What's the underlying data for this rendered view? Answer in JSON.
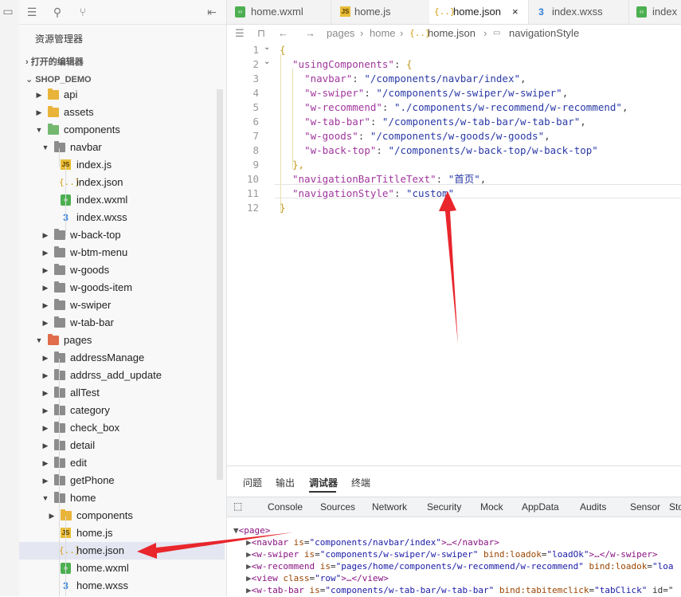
{
  "sidebar": {
    "title": "资源管理器",
    "open_editors": "打开的编辑器",
    "project": "SHOP_DEMO",
    "tree": [
      {
        "label": "api",
        "kind": "folder",
        "color": "yellow",
        "depth": 1,
        "arrow": "right"
      },
      {
        "label": "assets",
        "kind": "folder",
        "color": "yellow",
        "depth": 1,
        "arrow": "right"
      },
      {
        "label": "components",
        "kind": "folder",
        "color": "green",
        "depth": 1,
        "arrow": "down"
      },
      {
        "label": "navbar",
        "kind": "folder",
        "color": "gray",
        "depth": 2,
        "arrow": "down"
      },
      {
        "label": "index.js",
        "kind": "js",
        "depth": 3
      },
      {
        "label": "index.json",
        "kind": "json",
        "depth": 3
      },
      {
        "label": "index.wxml",
        "kind": "wxml",
        "depth": 3
      },
      {
        "label": "index.wxss",
        "kind": "wxss",
        "depth": 3
      },
      {
        "label": "w-back-top",
        "kind": "folder",
        "color": "gray",
        "depth": 2,
        "arrow": "right"
      },
      {
        "label": "w-btm-menu",
        "kind": "folder",
        "color": "gray",
        "depth": 2,
        "arrow": "right"
      },
      {
        "label": "w-goods",
        "kind": "folder",
        "color": "gray",
        "depth": 2,
        "arrow": "right"
      },
      {
        "label": "w-goods-item",
        "kind": "folder",
        "color": "gray",
        "depth": 2,
        "arrow": "right"
      },
      {
        "label": "w-swiper",
        "kind": "folder",
        "color": "gray",
        "depth": 2,
        "arrow": "right"
      },
      {
        "label": "w-tab-bar",
        "kind": "folder",
        "color": "gray",
        "depth": 2,
        "arrow": "right"
      },
      {
        "label": "pages",
        "kind": "folder",
        "color": "red",
        "depth": 1,
        "arrow": "down"
      },
      {
        "label": "addressManage",
        "kind": "folder",
        "color": "gray",
        "depth": 2,
        "arrow": "right"
      },
      {
        "label": "addrss_add_update",
        "kind": "folder",
        "color": "gray",
        "depth": 2,
        "arrow": "right"
      },
      {
        "label": "allTest",
        "kind": "folder",
        "color": "gray",
        "depth": 2,
        "arrow": "right"
      },
      {
        "label": "category",
        "kind": "folder",
        "color": "gray",
        "depth": 2,
        "arrow": "right"
      },
      {
        "label": "check_box",
        "kind": "folder",
        "color": "gray",
        "depth": 2,
        "arrow": "right"
      },
      {
        "label": "detail",
        "kind": "folder",
        "color": "gray",
        "depth": 2,
        "arrow": "right"
      },
      {
        "label": "edit",
        "kind": "folder",
        "color": "gray",
        "depth": 2,
        "arrow": "right"
      },
      {
        "label": "getPhone",
        "kind": "folder",
        "color": "gray",
        "depth": 2,
        "arrow": "right"
      },
      {
        "label": "home",
        "kind": "folder",
        "color": "gray",
        "depth": 2,
        "arrow": "down"
      },
      {
        "label": "components",
        "kind": "folder",
        "color": "yellow",
        "depth": 3,
        "arrow": "right"
      },
      {
        "label": "home.js",
        "kind": "js",
        "depth": 3
      },
      {
        "label": "home.json",
        "kind": "json",
        "depth": 3,
        "selected": true
      },
      {
        "label": "home.wxml",
        "kind": "wxml",
        "depth": 3
      },
      {
        "label": "home.wxss",
        "kind": "wxss",
        "depth": 3
      }
    ]
  },
  "tabs": [
    {
      "label": "home.wxml",
      "kind": "wxml"
    },
    {
      "label": "home.js",
      "kind": "js"
    },
    {
      "label": "home.json",
      "kind": "json",
      "active": true,
      "close": "×"
    },
    {
      "label": "index.wxss",
      "kind": "wxss"
    },
    {
      "label": "index",
      "kind": "wxml"
    }
  ],
  "breadcrumb": [
    "pages",
    "home",
    "home.json",
    "navigationStyle"
  ],
  "code": {
    "line_numbers": [
      "1",
      "2",
      "3",
      "4",
      "5",
      "6",
      "7",
      "8",
      "9",
      "10",
      "11",
      "12"
    ],
    "lines": [
      [
        [
          "{",
          "bz"
        ]
      ],
      [
        [
          "  ",
          ""
        ],
        [
          "\"usingComponents\"",
          "k"
        ],
        [
          ": ",
          "p"
        ],
        [
          "{",
          "bz"
        ]
      ],
      [
        [
          "    ",
          ""
        ],
        [
          "\"navbar\"",
          "k"
        ],
        [
          ": ",
          "p"
        ],
        [
          "\"/components/navbar/index\"",
          "s"
        ],
        [
          ",",
          "p"
        ]
      ],
      [
        [
          "    ",
          ""
        ],
        [
          "\"w-swiper\"",
          "k"
        ],
        [
          ": ",
          "p"
        ],
        [
          "\"/components/w-swiper/w-swiper\"",
          "s"
        ],
        [
          ",",
          "p"
        ]
      ],
      [
        [
          "    ",
          ""
        ],
        [
          "\"w-recommend\"",
          "k"
        ],
        [
          ": ",
          "p"
        ],
        [
          "\"./components/w-recommend/w-recommend\"",
          "s"
        ],
        [
          ",",
          "p"
        ]
      ],
      [
        [
          "    ",
          ""
        ],
        [
          "\"w-tab-bar\"",
          "k"
        ],
        [
          ": ",
          "p"
        ],
        [
          "\"/components/w-tab-bar/w-tab-bar\"",
          "s"
        ],
        [
          ",",
          "p"
        ]
      ],
      [
        [
          "    ",
          ""
        ],
        [
          "\"w-goods\"",
          "k"
        ],
        [
          ": ",
          "p"
        ],
        [
          "\"/components/w-goods/w-goods\"",
          "s"
        ],
        [
          ",",
          "p"
        ]
      ],
      [
        [
          "    ",
          ""
        ],
        [
          "\"w-back-top\"",
          "k"
        ],
        [
          ": ",
          "p"
        ],
        [
          "\"/components/w-back-top/w-back-top\"",
          "s"
        ]
      ],
      [
        [
          "  ",
          ""
        ],
        [
          "},",
          "bz"
        ]
      ],
      [
        [
          "  ",
          ""
        ],
        [
          "\"navigationBarTitleText\"",
          "k"
        ],
        [
          ": ",
          "p"
        ],
        [
          "\"首页\"",
          "s"
        ],
        [
          ",",
          "p"
        ]
      ],
      [
        [
          "  ",
          ""
        ],
        [
          "\"navigationStyle\"",
          "k"
        ],
        [
          ": ",
          "p"
        ],
        [
          "\"custom\"",
          "s"
        ]
      ],
      [
        [
          "}",
          "bz"
        ]
      ]
    ]
  },
  "panel": {
    "tabs": [
      "问题",
      "输出",
      "调试器",
      "终端"
    ],
    "active_tab": "调试器",
    "devtools_tabs": [
      "Console",
      "Sources",
      "Network",
      "Security",
      "Mock",
      "AppData",
      "Audits",
      "Sensor",
      "Sto"
    ],
    "dom": [
      {
        "indent": 0,
        "tri": "▼",
        "parts": [
          [
            "<page>",
            "tag"
          ]
        ]
      },
      {
        "indent": 1,
        "tri": "▶",
        "parts": [
          [
            "<navbar ",
            "tag"
          ],
          [
            "is",
            "an"
          ],
          [
            "=",
            "dt"
          ],
          [
            "\"components/navbar/index\"",
            "av"
          ],
          [
            ">…</navbar>",
            "tag"
          ]
        ]
      },
      {
        "indent": 1,
        "tri": "▶",
        "parts": [
          [
            "<w-swiper ",
            "tag"
          ],
          [
            "is",
            "an"
          ],
          [
            "=",
            "dt"
          ],
          [
            "\"components/w-swiper/w-swiper\"",
            "av"
          ],
          [
            " ",
            "dt"
          ],
          [
            "bind:loadok",
            "an"
          ],
          [
            "=",
            "dt"
          ],
          [
            "\"loadOk\"",
            "av"
          ],
          [
            ">…</w-swiper>",
            "tag"
          ]
        ]
      },
      {
        "indent": 1,
        "tri": "▶",
        "parts": [
          [
            "<w-recommend ",
            "tag"
          ],
          [
            "is",
            "an"
          ],
          [
            "=",
            "dt"
          ],
          [
            "\"pages/home/components/w-recommend/w-recommend\"",
            "av"
          ],
          [
            " ",
            "dt"
          ],
          [
            "bind:loadok",
            "an"
          ],
          [
            "=",
            "dt"
          ],
          [
            "\"loa",
            "av"
          ]
        ]
      },
      {
        "indent": 1,
        "tri": "▶",
        "parts": [
          [
            "<view ",
            "tag"
          ],
          [
            "class",
            "an"
          ],
          [
            "=",
            "dt"
          ],
          [
            "\"row\"",
            "av"
          ],
          [
            ">…</view>",
            "tag"
          ]
        ]
      },
      {
        "indent": 1,
        "tri": "▶",
        "parts": [
          [
            "<w-tab-bar ",
            "tag"
          ],
          [
            "is",
            "an"
          ],
          [
            "=",
            "dt"
          ],
          [
            "\"components/w-tab-bar/w-tab-bar\"",
            "av"
          ],
          [
            " ",
            "dt"
          ],
          [
            "bind:tabitemclick",
            "an"
          ],
          [
            "=",
            "dt"
          ],
          [
            "\"tabClick\"",
            "av"
          ],
          [
            " id=\"",
            "dt"
          ]
        ]
      }
    ]
  },
  "colors": {
    "arrow": "#e8262c",
    "accent": "#333333"
  }
}
